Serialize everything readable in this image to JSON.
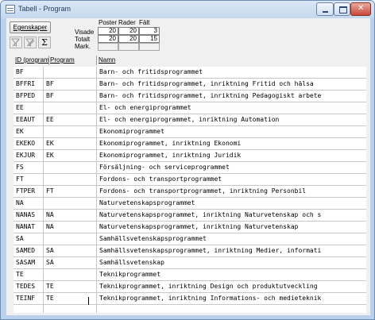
{
  "window": {
    "title": "Tabell - Program",
    "icon": "table-icon"
  },
  "toolbar": {
    "properties_label": "Egenskaper",
    "filter_icon": "funnel-icon",
    "filter_all_icon": "funnel-all-icon",
    "sum_label": "Σ"
  },
  "stats": {
    "col_posts": "Poster",
    "col_rows": "Rader",
    "col_fields": "Fält",
    "rows": [
      {
        "label": "Visade",
        "posts": "20",
        "rows": "20",
        "fields": "3"
      },
      {
        "label": "Totalt",
        "posts": "20",
        "rows": "20",
        "fields": "15"
      },
      {
        "label": "Mark.",
        "posts": "",
        "rows": "",
        "fields": ""
      }
    ]
  },
  "columns": {
    "id": "ID (program)",
    "program": "Program",
    "name": "Namn"
  },
  "rows": [
    {
      "id": "BF",
      "program": "",
      "name": "Barn- och fritidsprogrammet"
    },
    {
      "id": "BFFRI",
      "program": "BF",
      "name": "Barn- och fritidsprogrammet, inriktning Fritid och hälsa"
    },
    {
      "id": "BFPED",
      "program": "BF",
      "name": "Barn- och fritidsprogrammet, inriktning Pedagogiskt arbete"
    },
    {
      "id": "EE",
      "program": "",
      "name": "El- och energiprogrammet"
    },
    {
      "id": "EEAUT",
      "program": "EE",
      "name": "El- och energiprogrammet, inriktning Automation"
    },
    {
      "id": "EK",
      "program": "",
      "name": "Ekonomiprogrammet"
    },
    {
      "id": "EKEKO",
      "program": "EK",
      "name": "Ekonomiprogrammet, inriktning Ekonomi"
    },
    {
      "id": "EKJUR",
      "program": "EK",
      "name": "Ekonomiprogrammet, inriktning Juridik"
    },
    {
      "id": "FS",
      "program": "",
      "name": "Försäljning- och serviceprogrammet"
    },
    {
      "id": "FT",
      "program": "",
      "name": "Fordons- och transportprogrammet"
    },
    {
      "id": "FTPER",
      "program": "FT",
      "name": "Fordons- och transportprogrammet, inriktning Personbil"
    },
    {
      "id": "NA",
      "program": "",
      "name": "Naturvetenskapsprogrammet"
    },
    {
      "id": "NANAS",
      "program": "NA",
      "name": "Naturvetenskapsprogrammet, inriktning Naturvetenskap och s"
    },
    {
      "id": "NANAT",
      "program": "NA",
      "name": "Naturvetenskapsprogrammet, inriktning Naturvetenskap"
    },
    {
      "id": "SA",
      "program": "",
      "name": "Samhällsvetenskapsprogrammet"
    },
    {
      "id": "SAMED",
      "program": "SA",
      "name": "Samhällsvetenskapsprogrammet, inriktning Medier, informati"
    },
    {
      "id": "SASAM",
      "program": "SA",
      "name": "Samhällsvetenskap"
    },
    {
      "id": "TE",
      "program": "",
      "name": "Teknikprogrammet"
    },
    {
      "id": "TEDES",
      "program": "TE",
      "name": "Teknikprogrammet, inriktning Design och produktutveckling"
    },
    {
      "id": "TEINF",
      "program": "TE",
      "name": "Teknikprogrammet, inriktning Informations- och medieteknik"
    }
  ]
}
